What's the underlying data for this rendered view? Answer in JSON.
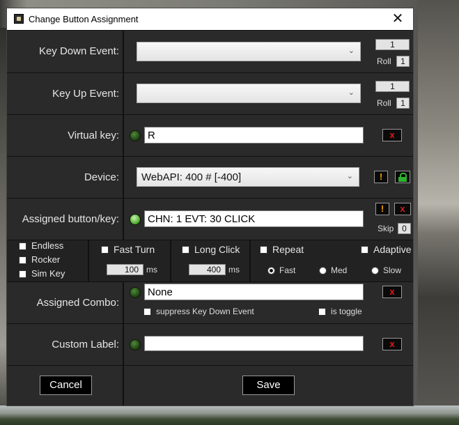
{
  "window": {
    "title": "Change Button Assignment",
    "close_glyph": "✕"
  },
  "key_down": {
    "label": "Key Down Event:",
    "value": "",
    "count": "1",
    "roll_label": "Roll",
    "roll_value": "1"
  },
  "key_up": {
    "label": "Key Up Event:",
    "value": "",
    "count": "1",
    "roll_label": "Roll",
    "roll_value": "1"
  },
  "virtual_key": {
    "label": "Virtual key:",
    "value": "R",
    "clear_label": "x"
  },
  "device": {
    "label": "Device:",
    "value": "WebAPI: 400 # [-400]",
    "warn_label": "!"
  },
  "assigned": {
    "label": "Assigned button/key:",
    "value": "CHN: 1 EVT: 30 CLICK",
    "warn_label": "!",
    "clear_label": "x",
    "skip_label": "Skip",
    "skip_value": "0"
  },
  "options": {
    "endless": "Endless",
    "rocker": "Rocker",
    "sim_key": "Sim Key",
    "fast_turn": "Fast Turn",
    "fast_turn_value": "100",
    "fast_turn_unit": "ms",
    "long_click": "Long Click",
    "long_click_value": "400",
    "long_click_unit": "ms",
    "repeat": "Repeat",
    "adaptive": "Adaptive",
    "speed_fast": "Fast",
    "speed_med": "Med",
    "speed_slow": "Slow"
  },
  "combo": {
    "label": "Assigned Combo:",
    "value": "None",
    "clear_label": "x",
    "suppress": "suppress Key Down Event",
    "toggle": "is toggle"
  },
  "custom": {
    "label": "Custom Label:",
    "value": "",
    "clear_label": "x"
  },
  "buttons": {
    "cancel": "Cancel",
    "save": "Save"
  },
  "colors": {
    "led_off": "#1d3d12",
    "led_on": "#59b338",
    "clear_red": "#e01818",
    "warn_orange": "#f0a000"
  }
}
